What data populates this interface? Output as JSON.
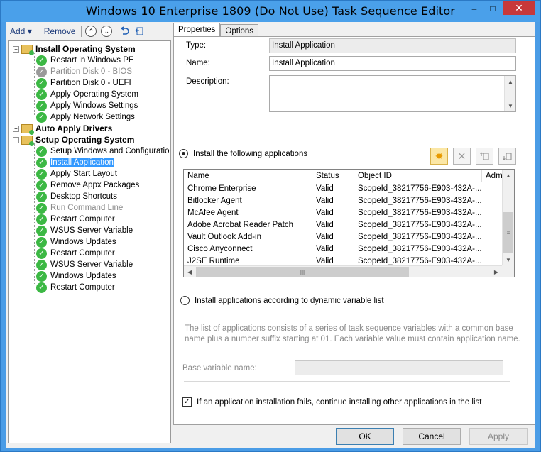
{
  "window": {
    "title": "Windows 10 Enterprise 1809 (Do Not Use) Task Sequence Editor",
    "minimize_glyph": "–",
    "maximize_glyph": "□",
    "close_glyph": "✕"
  },
  "toolbar": {
    "add_label": "Add",
    "add_arrow": "▾",
    "remove_label": "Remove",
    "move_up_glyph": "⌃",
    "move_down_glyph": "⌄"
  },
  "tree": {
    "groups": [
      {
        "label": "Install Operating System",
        "expander": "−",
        "steps": [
          {
            "label": "Restart in Windows PE",
            "state": "normal"
          },
          {
            "label": "Partition Disk 0 - BIOS",
            "state": "disabled"
          },
          {
            "label": "Partition Disk 0 - UEFI",
            "state": "normal"
          },
          {
            "label": "Apply Operating System",
            "state": "normal"
          },
          {
            "label": "Apply Windows Settings",
            "state": "normal"
          },
          {
            "label": "Apply Network Settings",
            "state": "normal"
          }
        ]
      },
      {
        "label": "Auto Apply Drivers",
        "expander": "+",
        "steps": []
      },
      {
        "label": "Setup Operating System",
        "expander": "−",
        "steps": [
          {
            "label": "Setup Windows and Configuration",
            "state": "normal"
          },
          {
            "label": "Install Application",
            "state": "selected"
          },
          {
            "label": "Apply Start Layout",
            "state": "normal"
          },
          {
            "label": "Remove Appx Packages",
            "state": "normal"
          },
          {
            "label": "Desktop Shortcuts",
            "state": "normal"
          },
          {
            "label": "Run Command Line",
            "state": "disabled"
          },
          {
            "label": "Restart Computer",
            "state": "normal"
          },
          {
            "label": "WSUS Server Variable",
            "state": "normal"
          },
          {
            "label": "Windows Updates",
            "state": "normal"
          },
          {
            "label": "Restart Computer",
            "state": "normal"
          },
          {
            "label": "WSUS Server Variable",
            "state": "normal"
          },
          {
            "label": "Windows Updates",
            "state": "normal"
          },
          {
            "label": "Restart Computer",
            "state": "normal"
          }
        ]
      }
    ]
  },
  "tabs": [
    {
      "label": "Properties",
      "active": true
    },
    {
      "label": "Options",
      "active": false
    }
  ],
  "properties": {
    "type_label": "Type:",
    "type_value": "Install Application",
    "name_label": "Name:",
    "name_value": "Install Application",
    "description_label": "Description:",
    "description_value": "",
    "option_following_label": "Install the following applications",
    "option_following_selected": true,
    "option_dynamic_label": "Install applications according to dynamic variable list",
    "option_dynamic_selected": false,
    "info_text": "The list of applications consists of a series of task sequence variables with a common base name plus a number suffix starting at 01. Each variable value must contain application name.",
    "base_variable_label": "Base variable name:",
    "base_variable_value": "",
    "continue_on_fail_label": "If an application installation fails, continue installing other applications in the list",
    "continue_on_fail_checked": true,
    "check_glyph": "✓"
  },
  "applications": {
    "columns": [
      "Name",
      "Status",
      "Object ID",
      "Admi"
    ],
    "rows": [
      {
        "name": "Chrome Enterprise",
        "status": "Valid",
        "object_id": "ScopeId_38217756-E903-432A-..."
      },
      {
        "name": "Bitlocker Agent",
        "status": "Valid",
        "object_id": "ScopeId_38217756-E903-432A-..."
      },
      {
        "name": "McAfee Agent",
        "status": "Valid",
        "object_id": "ScopeId_38217756-E903-432A-..."
      },
      {
        "name": "Adobe Acrobat Reader Patch",
        "status": "Valid",
        "object_id": "ScopeId_38217756-E903-432A-..."
      },
      {
        "name": "Vault Outlook Add-in",
        "status": "Valid",
        "object_id": "ScopeId_38217756-E903-432A-..."
      },
      {
        "name": "Cisco Anyconnect",
        "status": "Valid",
        "object_id": "ScopeId_38217756-E903-432A-..."
      },
      {
        "name": "J2SE Runtime",
        "status": "Valid",
        "object_id": "ScopeId_38217756-E903-432A-..."
      }
    ]
  },
  "dialog_buttons": {
    "ok": "OK",
    "cancel": "Cancel",
    "apply": "Apply"
  }
}
